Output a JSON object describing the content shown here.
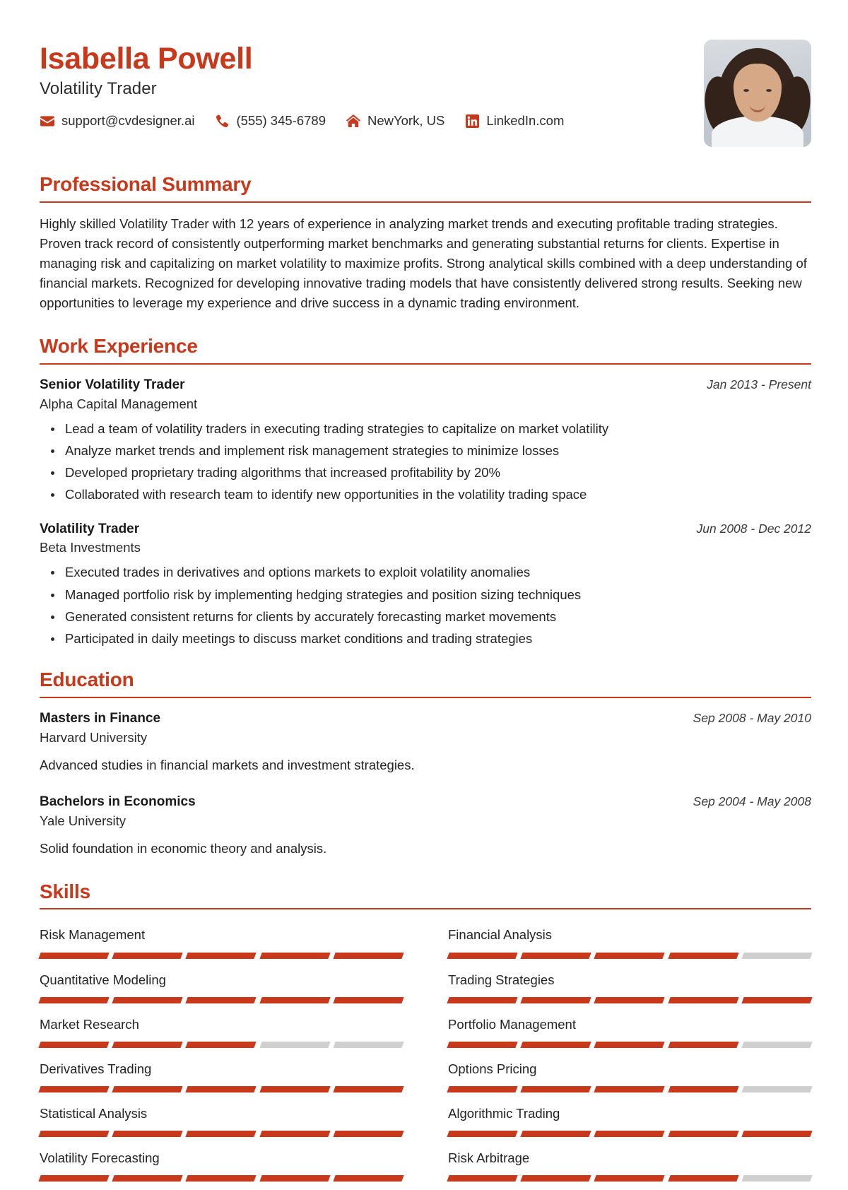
{
  "accent_color": "#C8381B",
  "header": {
    "name": "Isabella Powell",
    "job_title": "Volatility Trader",
    "contacts": [
      {
        "icon": "envelope-icon",
        "text": "support@cvdesigner.ai"
      },
      {
        "icon": "phone-icon",
        "text": "(555) 345-6789"
      },
      {
        "icon": "home-icon",
        "text": "NewYork, US"
      },
      {
        "icon": "linkedin-icon",
        "text": "LinkedIn.com"
      }
    ],
    "photo_alt": "profile-photo"
  },
  "summary": {
    "title": "Professional Summary",
    "text": "Highly skilled Volatility Trader with 12 years of experience in analyzing market trends and executing profitable trading strategies. Proven track record of consistently outperforming market benchmarks and generating substantial returns for clients. Expertise in managing risk and capitalizing on market volatility to maximize profits. Strong analytical skills combined with a deep understanding of financial markets. Recognized for developing innovative trading models that have consistently delivered strong results. Seeking new opportunities to leverage my experience and drive success in a dynamic trading environment."
  },
  "work": {
    "title": "Work Experience",
    "entries": [
      {
        "role": "Senior Volatility Trader",
        "organization": "Alpha Capital Management",
        "date": "Jan 2013 - Present",
        "bullets": [
          "Lead a team of volatility traders in executing trading strategies to capitalize on market volatility",
          "Analyze market trends and implement risk management strategies to minimize losses",
          "Developed proprietary trading algorithms that increased profitability by 20%",
          "Collaborated with research team to identify new opportunities in the volatility trading space"
        ]
      },
      {
        "role": "Volatility Trader",
        "organization": "Beta Investments",
        "date": "Jun 2008 - Dec 2012",
        "bullets": [
          "Executed trades in derivatives and options markets to exploit volatility anomalies",
          "Managed portfolio risk by implementing hedging strategies and position sizing techniques",
          "Generated consistent returns for clients by accurately forecasting market movements",
          "Participated in daily meetings to discuss market conditions and trading strategies"
        ]
      }
    ]
  },
  "education": {
    "title": "Education",
    "entries": [
      {
        "degree": "Masters in Finance",
        "school": "Harvard University",
        "date": "Sep 2008 - May 2010",
        "description": "Advanced studies in financial markets and investment strategies."
      },
      {
        "degree": "Bachelors in Economics",
        "school": "Yale University",
        "date": "Sep 2004 - May 2008",
        "description": "Solid foundation in economic theory and analysis."
      }
    ]
  },
  "skills": {
    "title": "Skills",
    "max_level": 5,
    "items": [
      {
        "name": "Risk Management",
        "level": 5
      },
      {
        "name": "Financial Analysis",
        "level": 4
      },
      {
        "name": "Quantitative Modeling",
        "level": 5
      },
      {
        "name": "Trading Strategies",
        "level": 5
      },
      {
        "name": "Market Research",
        "level": 3
      },
      {
        "name": "Portfolio Management",
        "level": 4
      },
      {
        "name": "Derivatives Trading",
        "level": 5
      },
      {
        "name": "Options Pricing",
        "level": 4
      },
      {
        "name": "Statistical Analysis",
        "level": 5
      },
      {
        "name": "Algorithmic Trading",
        "level": 5
      },
      {
        "name": "Volatility Forecasting",
        "level": 5
      },
      {
        "name": "Risk Arbitrage",
        "level": 4
      }
    ]
  }
}
